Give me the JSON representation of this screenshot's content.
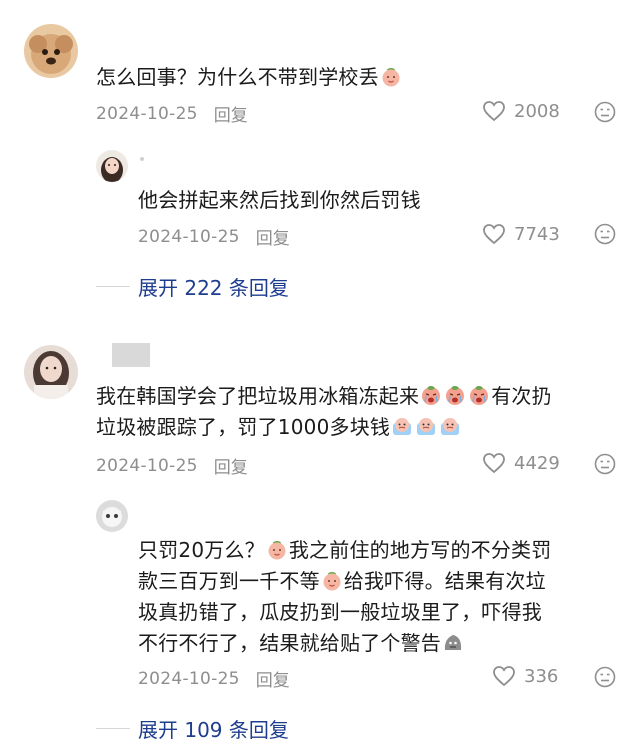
{
  "comments": [
    {
      "text_parts": [
        "怎么回事？为什么不带到学校丢"
      ],
      "date": "2024-10-25",
      "reply_label": "回复",
      "likes": "2008",
      "replies": [
        {
          "text": "他会拼起来然后找到你然后罚钱",
          "date": "2024-10-25",
          "reply_label": "回复",
          "likes": "7743"
        }
      ],
      "expand_label": "展开 222 条回复"
    },
    {
      "text_line1_a": "我在韩国学会了把垃圾用冰箱冻起来",
      "text_line1_b": "有次扔",
      "text_line2_a": "垃圾被跟踪了，罚了1000多块钱",
      "date": "2024-10-25",
      "reply_label": "回复",
      "likes": "4429",
      "replies": [
        {
          "line1_a": "只罚20万么？",
          "line1_b": "我之前住的地方写的不分类罚",
          "line2_a": "款三百万到一千不等",
          "line2_b": "给我吓得。结果有次垃",
          "line3": "圾真扔错了，瓜皮扔到一般垃圾里了，吓得我",
          "line4_a": "不行不行了，结果就给贴了个警告",
          "date": "2024-10-25",
          "reply_label": "回复",
          "likes": "336"
        }
      ],
      "expand_label": "展开 109 条回复"
    }
  ],
  "icons": {
    "like": "heart-outline-icon",
    "dislike": "frown-face-icon",
    "emoji_smile": "peach-smile-emoji",
    "emoji_cry": "crying-face-emoji",
    "emoji_sweat": "sweat-face-emoji",
    "emoji_rock": "grey-blob-emoji"
  },
  "colors": {
    "link": "#1e3d8f",
    "meta": "#8e8e8e",
    "text": "#1b1b1b"
  }
}
